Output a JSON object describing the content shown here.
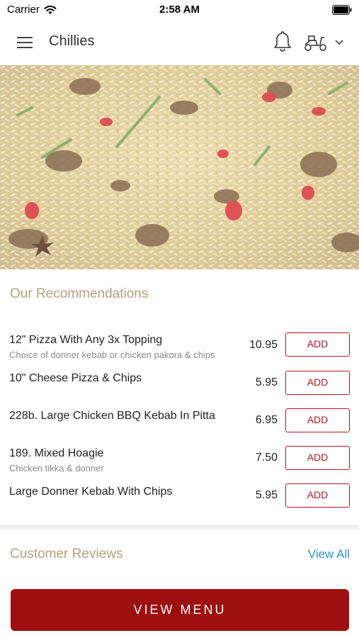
{
  "status_bar": {
    "carrier": "Carrier",
    "time": "2:58 AM"
  },
  "header": {
    "title": "Chillies"
  },
  "icons": {
    "menu": "hamburger-icon",
    "notifications": "bell-icon",
    "delivery": "scooter-icon",
    "dropdown": "chevron-down-icon"
  },
  "recommendations": {
    "title": "Our Recommendations",
    "add_label": "ADD",
    "items": [
      {
        "name": "12\" Pizza With Any 3x Topping",
        "description": "Choice of donner kebab or chicken pakora & chips",
        "price": "10.95"
      },
      {
        "name": "10\" Cheese Pizza & Chips",
        "description": "",
        "price": "5.95"
      },
      {
        "name": "228b. Large Chicken BBQ Kebab In Pitta",
        "description": "",
        "price": "6.95"
      },
      {
        "name": "189. Mixed Hoagie",
        "description": "Chicken tikka & donner",
        "price": "7.50"
      },
      {
        "name": "Large Donner Kebab With Chips",
        "description": "",
        "price": "5.95"
      }
    ]
  },
  "reviews": {
    "title": "Customer Reviews",
    "view_all": "View All"
  },
  "cta": {
    "label": "VIEW MENU"
  },
  "colors": {
    "accent": "#9e0f0f",
    "section_title": "#b5a27c",
    "link": "#2a91c9"
  }
}
